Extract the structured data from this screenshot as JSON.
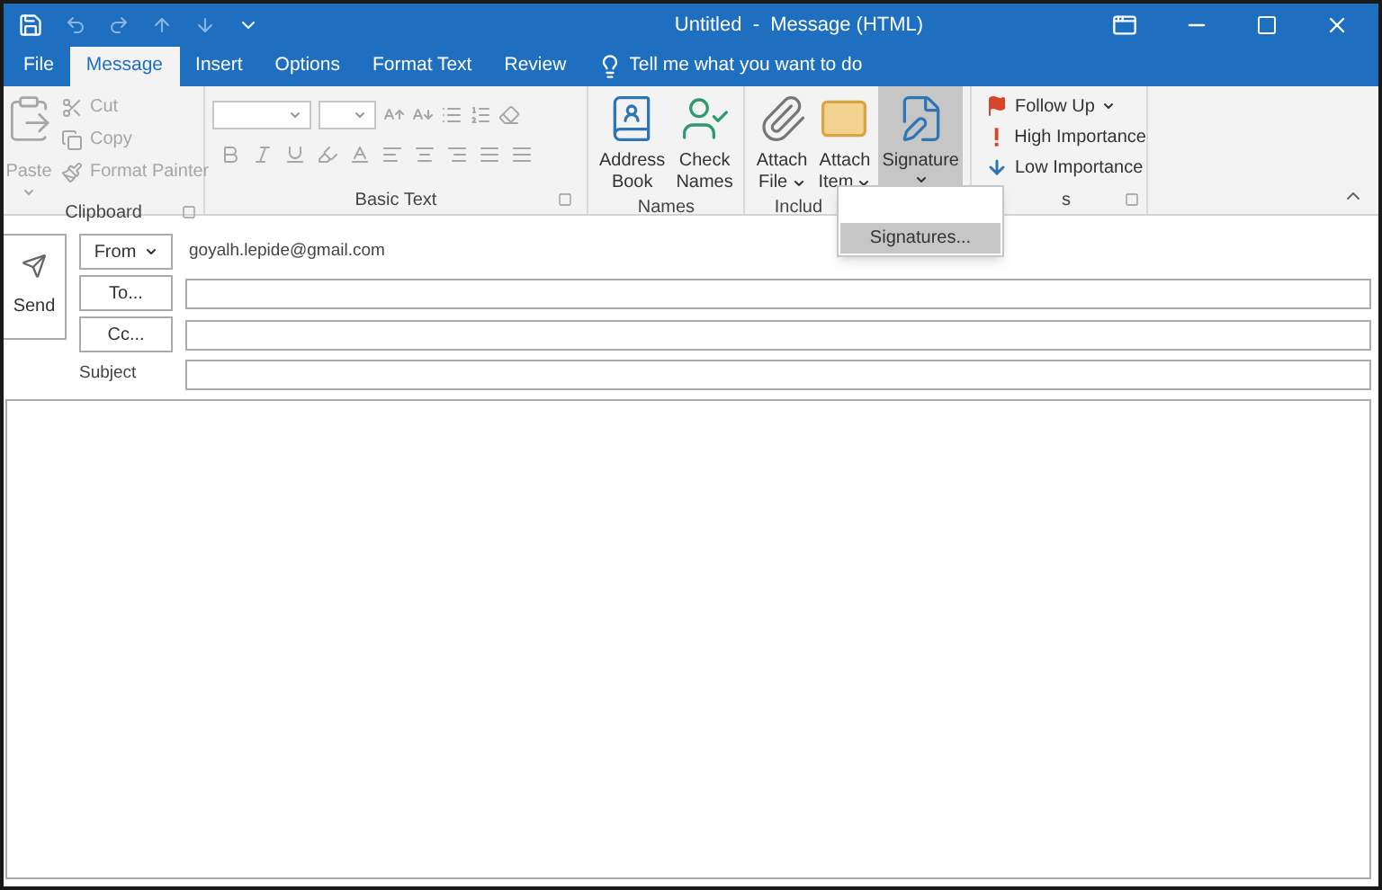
{
  "window": {
    "title": "Untitled  -  Message (HTML)"
  },
  "tabs": [
    {
      "label": "File",
      "selected": false
    },
    {
      "label": "Message",
      "selected": true
    },
    {
      "label": "Insert",
      "selected": false
    },
    {
      "label": "Options",
      "selected": false
    },
    {
      "label": "Format Text",
      "selected": false
    },
    {
      "label": "Review",
      "selected": false
    }
  ],
  "tell_me": {
    "placeholder": "Tell me what you want to do"
  },
  "ribbon": {
    "groups": [
      {
        "kind": "clipboard",
        "label": "Clipboard",
        "items": [
          {
            "label": "Paste",
            "disabled": true
          },
          {
            "label": "Cut",
            "disabled": true
          },
          {
            "label": "Copy",
            "disabled": true
          },
          {
            "label": "Format Painter",
            "disabled": true
          }
        ]
      },
      {
        "kind": "basic_text",
        "label": "Basic Text"
      },
      {
        "kind": "names",
        "label": "Names",
        "items": [
          {
            "lines": [
              "Address",
              "Book"
            ],
            "dropdown": false,
            "selected": false
          },
          {
            "lines": [
              "Check",
              "Names"
            ],
            "dropdown": false,
            "selected": false
          }
        ]
      },
      {
        "kind": "include",
        "label": "Includ",
        "items": [
          {
            "lines": [
              "Attach",
              "File"
            ],
            "dropdown": true,
            "selected": false
          },
          {
            "lines": [
              "Attach",
              "Item"
            ],
            "dropdown": true,
            "selected": false
          },
          {
            "lines": [
              "Signature"
            ],
            "dropdown": true,
            "selected": true
          }
        ]
      },
      {
        "kind": "tags",
        "label": "s",
        "items": [
          {
            "label": "Follow Up",
            "dropdown": true
          },
          {
            "label": "High Importance",
            "dropdown": false
          },
          {
            "label": "Low Importance",
            "dropdown": false
          }
        ]
      }
    ]
  },
  "menu": {
    "items": [
      {
        "label": "Signatures...",
        "selected": true
      }
    ]
  },
  "compose": {
    "send": "Send",
    "from_button": "From",
    "from_value": "goyalh.lepide@gmail.com",
    "to_button": "To...",
    "cc_button": "Cc...",
    "subject_label": "Subject"
  }
}
